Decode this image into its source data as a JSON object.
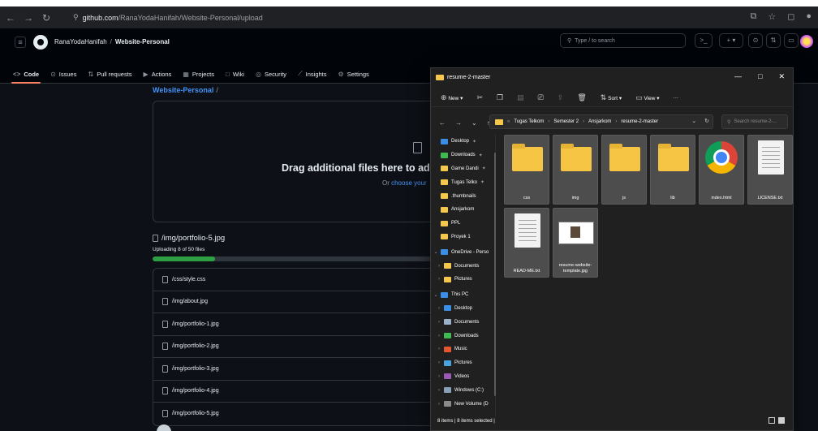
{
  "browser": {
    "url_host": "github.com",
    "url_path": "/RanaYodaHanifah/Website-Personal/upload"
  },
  "github": {
    "owner": "RanaYodaHanifah",
    "separator": "/",
    "repo": "Website-Personal",
    "search_placeholder": "Type / to search",
    "tabs": [
      {
        "label": "Code",
        "icon": "code-icon",
        "glyph": "<>"
      },
      {
        "label": "Issues",
        "icon": "issue-icon",
        "glyph": "⊙"
      },
      {
        "label": "Pull requests",
        "icon": "pull-request-icon",
        "glyph": "⇅"
      },
      {
        "label": "Actions",
        "icon": "play-icon",
        "glyph": "▶"
      },
      {
        "label": "Projects",
        "icon": "table-icon",
        "glyph": "▦"
      },
      {
        "label": "Wiki",
        "icon": "book-icon",
        "glyph": "□"
      },
      {
        "label": "Security",
        "icon": "shield-icon",
        "glyph": "◎"
      },
      {
        "label": "Insights",
        "icon": "graph-icon",
        "glyph": "⟋"
      },
      {
        "label": "Settings",
        "icon": "gear-icon",
        "glyph": "⚙"
      }
    ],
    "breadcrumb_repo": "Website-Personal",
    "breadcrumb_sep": "/",
    "drop_title": "Drag additional files here to add",
    "drop_sub_prefix": "Or ",
    "drop_sub_link": "choose your",
    "uploading_file": "/img/portfolio-5.jpg",
    "upload_status": "Uploading 8 of 50 files",
    "upload_progress": 0.215,
    "files": [
      "/css/style.css",
      "/img/about.jpg",
      "/img/portfolio-1.jpg",
      "/img/portfolio-2.jpg",
      "/img/portfolio-3.jpg",
      "/img/portfolio-4.jpg",
      "/img/portfolio-5.jpg"
    ],
    "accent_color": "#f78166",
    "link_color": "#4493f8",
    "progress_color": "#2ea043"
  },
  "explorer": {
    "title": "resume-2-master",
    "toolbar": {
      "new_label": "New",
      "sort_label": "Sort",
      "view_label": "View",
      "more": "···"
    },
    "address": [
      "Tugas Telkom",
      "Semester 2",
      "Ansjarkom",
      "resume-2-master"
    ],
    "address_prefix": "«",
    "search_placeholder": "Search resume-2-...",
    "nav": [
      {
        "label": "Desktop",
        "color": "#3a8ee6",
        "pin": true,
        "indent": false,
        "chevron": ""
      },
      {
        "label": "Downloads",
        "color": "#3fb950",
        "pin": true,
        "indent": false,
        "chevron": ""
      },
      {
        "label": "Game Dandi",
        "color": "#f5c84c",
        "pin": true,
        "indent": false,
        "chevron": ""
      },
      {
        "label": "Tugas Telko",
        "color": "#f5c84c",
        "pin": true,
        "indent": false,
        "chevron": ""
      },
      {
        "label": ".thumbnails",
        "color": "#f5c84c",
        "pin": false,
        "indent": false,
        "chevron": ""
      },
      {
        "label": "Ansjarkom",
        "color": "#f5c84c",
        "pin": false,
        "indent": false,
        "chevron": ""
      },
      {
        "label": "PPL",
        "color": "#f5c84c",
        "pin": false,
        "indent": false,
        "chevron": ""
      },
      {
        "label": "Proyek 1",
        "color": "#f5c84c",
        "pin": false,
        "indent": false,
        "chevron": ""
      },
      {
        "label": "OneDrive - Perso",
        "color": "#3a8ee6",
        "pin": false,
        "indent": false,
        "chevron": "v"
      },
      {
        "label": "Documents",
        "color": "#f5c84c",
        "pin": false,
        "indent": true,
        "chevron": ">"
      },
      {
        "label": "Pictures",
        "color": "#f5c84c",
        "pin": false,
        "indent": true,
        "chevron": ">"
      },
      {
        "label": "This PC",
        "color": "#3a8ee6",
        "pin": false,
        "indent": false,
        "chevron": "v"
      },
      {
        "label": "Desktop",
        "color": "#3a8ee6",
        "pin": false,
        "indent": true,
        "chevron": ">"
      },
      {
        "label": "Documents",
        "color": "#9ab0c8",
        "pin": false,
        "indent": true,
        "chevron": ">"
      },
      {
        "label": "Downloads",
        "color": "#3fb950",
        "pin": false,
        "indent": true,
        "chevron": ">"
      },
      {
        "label": "Music",
        "color": "#e4572e",
        "pin": false,
        "indent": true,
        "chevron": ">"
      },
      {
        "label": "Pictures",
        "color": "#4aa3df",
        "pin": false,
        "indent": true,
        "chevron": ">"
      },
      {
        "label": "Videos",
        "color": "#9b59b6",
        "pin": false,
        "indent": true,
        "chevron": ">"
      },
      {
        "label": "Windows (C:)",
        "color": "#8aa0b8",
        "pin": false,
        "indent": true,
        "chevron": ">"
      },
      {
        "label": "New Volume (D",
        "color": "#8a8a8a",
        "pin": false,
        "indent": true,
        "chevron": ">"
      }
    ],
    "items": [
      {
        "label": "css",
        "kind": "folder"
      },
      {
        "label": "img",
        "kind": "folder"
      },
      {
        "label": "js",
        "kind": "folder"
      },
      {
        "label": "lib",
        "kind": "folder"
      },
      {
        "label": "index.html",
        "kind": "chrome"
      },
      {
        "label": "LICENSE.txt",
        "kind": "doc"
      },
      {
        "label": "READ-ME.txt",
        "kind": "doc"
      },
      {
        "label": "resume-website-template.jpg",
        "kind": "image"
      }
    ],
    "status": "8 items  |  8 items selected  |"
  }
}
